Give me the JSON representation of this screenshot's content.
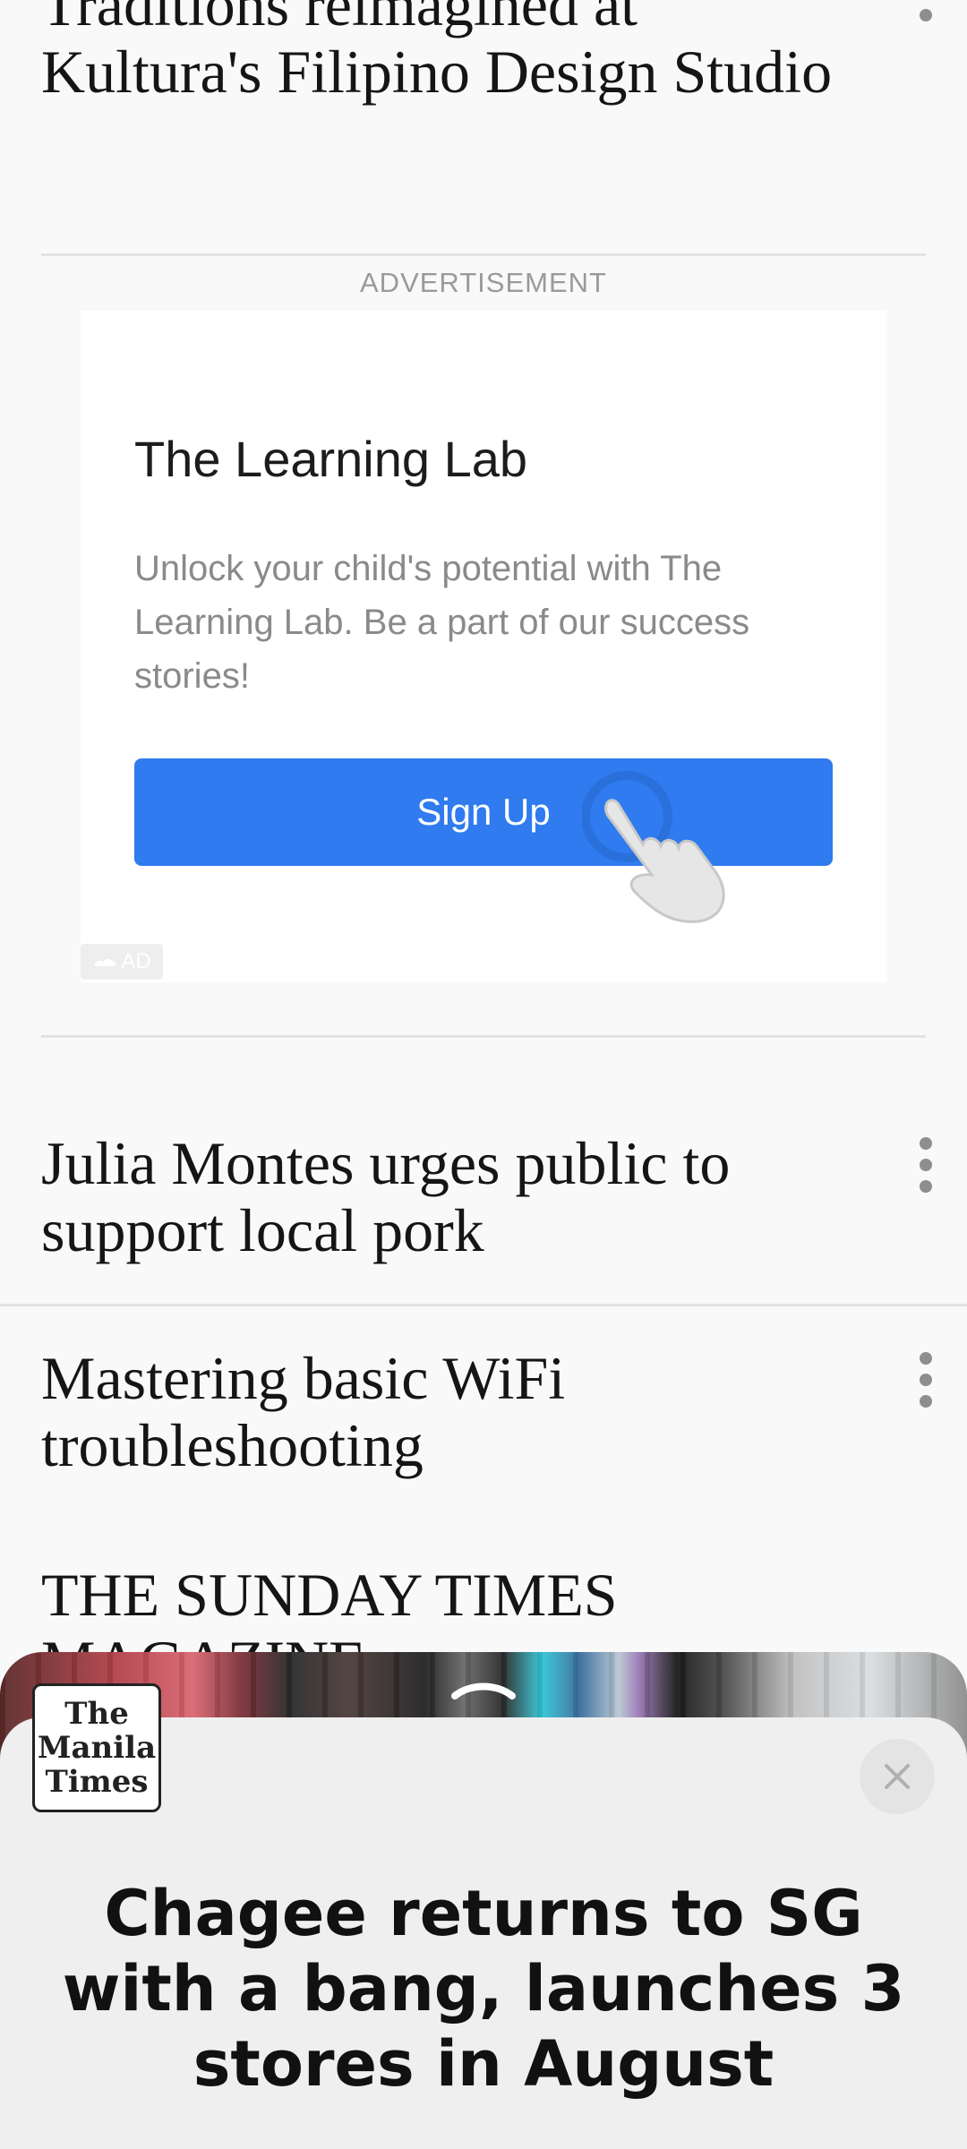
{
  "articles": {
    "top_title": "Traditions reimagined at Kultura's Filipino Design Studio",
    "item1_title": "Julia Montes urges public to support local pork",
    "item2_title": "Mastering basic WiFi troubleshooting",
    "item3_title": "THE SUNDAY TIMES MAGAZINE"
  },
  "ad": {
    "label": "ADVERTISEMENT",
    "heading": "The Learning Lab",
    "body": "Unlock your child's potential with The Learning Lab. Be a part of our success stories!",
    "cta": "Sign Up",
    "badge": "AD",
    "cta_color": "#2f7bef"
  },
  "sheet": {
    "logo_lines": [
      "The",
      "Manila",
      "Times"
    ],
    "headline": "Chagee returns to SG with a bang, launches 3 stores in August",
    "close_icon": "close-icon",
    "handle_icon": "chevron-up-icon"
  }
}
